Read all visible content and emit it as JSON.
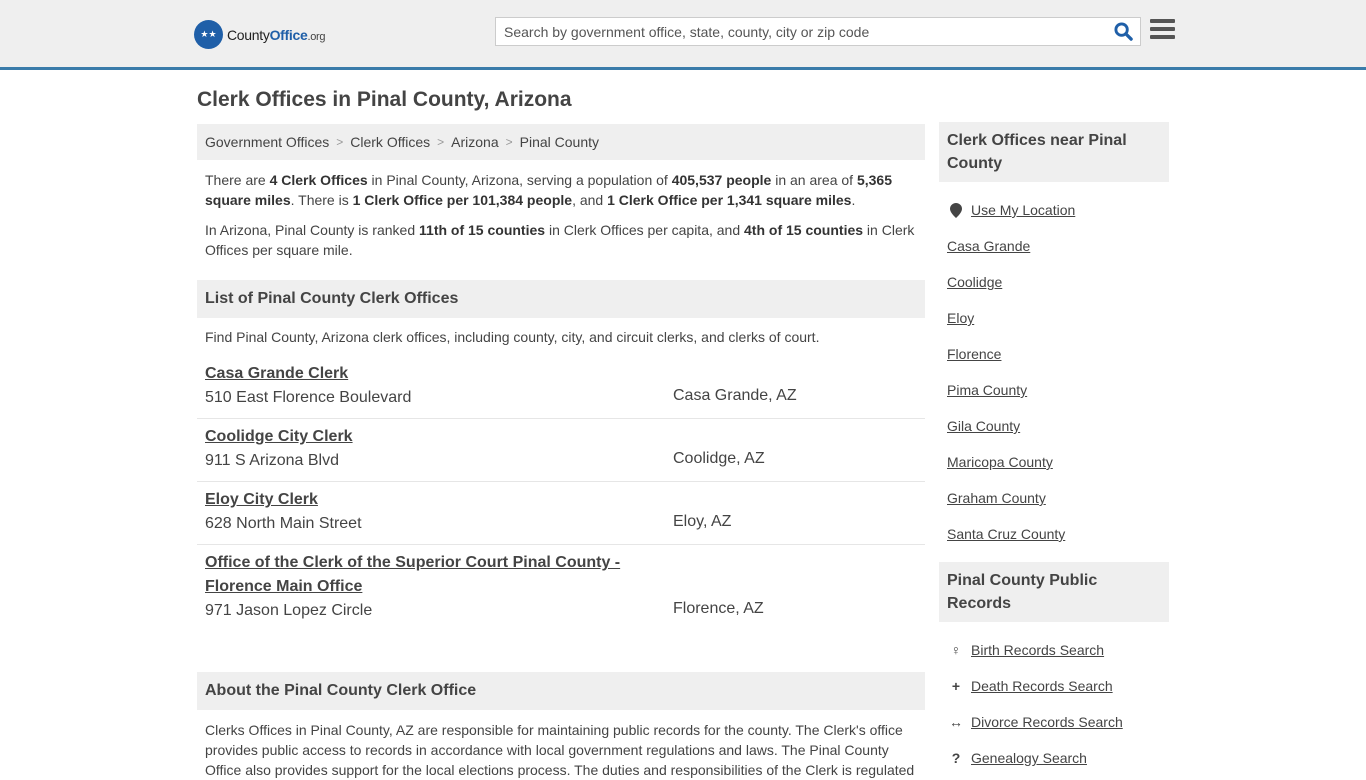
{
  "header": {
    "logo_text_a": "County",
    "logo_text_b": "Office",
    "logo_text_c": ".org",
    "search_placeholder": "Search by government office, state, county, city or zip code",
    "search_value": ""
  },
  "page_title": "Clerk Offices in Pinal County, Arizona",
  "breadcrumb": [
    "Government Offices",
    "Clerk Offices",
    "Arizona",
    "Pinal County"
  ],
  "intro": {
    "p1": [
      {
        "t": "There are ",
        "b": false
      },
      {
        "t": "4 Clerk Offices",
        "b": true
      },
      {
        "t": " in Pinal County, Arizona, serving a population of ",
        "b": false
      },
      {
        "t": "405,537 people",
        "b": true
      },
      {
        "t": " in an area of ",
        "b": false
      },
      {
        "t": "5,365 square miles",
        "b": true
      },
      {
        "t": ". There is ",
        "b": false
      },
      {
        "t": "1 Clerk Office per 101,384 people",
        "b": true
      },
      {
        "t": ", and ",
        "b": false
      },
      {
        "t": "1 Clerk Office per 1,341 square miles",
        "b": true
      },
      {
        "t": ".",
        "b": false
      }
    ],
    "p2": [
      {
        "t": "In Arizona, Pinal County is ranked ",
        "b": false
      },
      {
        "t": "11th of 15 counties",
        "b": true
      },
      {
        "t": " in Clerk Offices per capita, and ",
        "b": false
      },
      {
        "t": "4th of 15 counties",
        "b": true
      },
      {
        "t": " in Clerk Offices per square mile.",
        "b": false
      }
    ]
  },
  "list": {
    "heading": "List of Pinal County Clerk Offices",
    "description": "Find Pinal County, Arizona clerk offices, including county, city, and circuit clerks, and clerks of court.",
    "offices": [
      {
        "name": "Casa Grande Clerk",
        "address": "510 East Florence Boulevard",
        "city": "Casa Grande, AZ"
      },
      {
        "name": "Coolidge City Clerk",
        "address": "911 S Arizona Blvd",
        "city": "Coolidge, AZ"
      },
      {
        "name": "Eloy City Clerk",
        "address": "628 North Main Street",
        "city": "Eloy, AZ"
      },
      {
        "name": "Office of the Clerk of the Superior Court Pinal County - Florence Main Office",
        "address": "971 Jason Lopez Circle",
        "city": "Florence, AZ"
      }
    ]
  },
  "about": {
    "heading": "About the Pinal County Clerk Office",
    "text": "Clerks Offices in Pinal County, AZ are responsible for maintaining public records for the county. The Clerk's office provides public access to records in accordance with local government regulations and laws. The Pinal County Office also provides support for the local elections process. The duties and responsibilities of the Clerk is regulated"
  },
  "sidebar": {
    "nearby_heading": "Clerk Offices near Pinal County",
    "use_location": "Use My Location",
    "nearby": [
      "Casa Grande",
      "Coolidge",
      "Eloy",
      "Florence",
      "Pima County",
      "Gila County",
      "Maricopa County",
      "Graham County",
      "Santa Cruz County"
    ],
    "records_heading": "Pinal County Public Records",
    "records": [
      {
        "icon": "child-icon",
        "glyph": "♀",
        "label": "Birth Records Search"
      },
      {
        "icon": "cross-icon",
        "glyph": "+",
        "label": "Death Records Search"
      },
      {
        "icon": "arrows-horizontal-icon",
        "glyph": "↔",
        "label": "Divorce Records Search"
      },
      {
        "icon": "question-icon",
        "glyph": "?",
        "label": "Genealogy Search"
      }
    ]
  }
}
